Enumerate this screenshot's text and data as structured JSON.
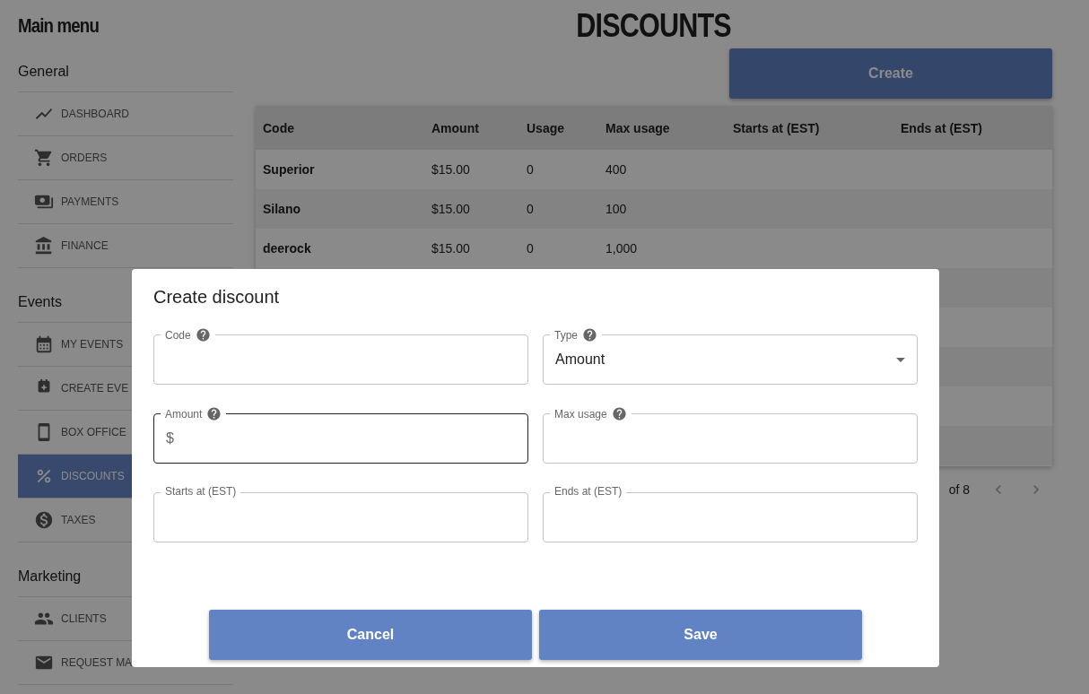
{
  "sidebar": {
    "title": "Main menu",
    "sections": [
      {
        "title": "General",
        "items": [
          {
            "label": "DASHBOARD",
            "selected": false
          },
          {
            "label": "ORDERS",
            "selected": false
          },
          {
            "label": "PAYMENTS",
            "selected": false
          },
          {
            "label": "FINANCE",
            "selected": false
          }
        ]
      },
      {
        "title": "Events",
        "items": [
          {
            "label": "MY EVENTS",
            "selected": false
          },
          {
            "label": "CREATE EVE",
            "selected": false
          },
          {
            "label": "BOX OFFICE",
            "selected": false
          },
          {
            "label": "DISCOUNTS",
            "selected": true
          },
          {
            "label": "TAXES",
            "selected": false
          }
        ]
      },
      {
        "title": "Marketing",
        "items": [
          {
            "label": "CLIENTS",
            "selected": false
          },
          {
            "label": "REQUEST MA",
            "selected": false
          }
        ]
      }
    ]
  },
  "page": {
    "title": "DISCOUNTS",
    "create_button": "Create"
  },
  "table": {
    "columns": [
      "Code",
      "Amount",
      "Usage",
      "Max usage",
      "Starts at (EST)",
      "Ends at (EST)"
    ],
    "rows": [
      [
        "Superior",
        "$15.00",
        "0",
        "400"
      ],
      [
        "Silano",
        "$15.00",
        "0",
        "100"
      ],
      [
        "deerock",
        "$15.00",
        "0",
        "1,000"
      ]
    ]
  },
  "pagination": {
    "label": "of 8"
  },
  "dialog": {
    "title": "Create discount",
    "fields": [
      {
        "kind": "text",
        "label": "Code",
        "help": true,
        "focused": false
      },
      {
        "kind": "select",
        "label": "Type",
        "help": true,
        "focused": false,
        "value": "Amount"
      },
      {
        "kind": "text",
        "label": "Amount",
        "help": true,
        "focused": true,
        "prefix": "$"
      },
      {
        "kind": "text",
        "label": "Max usage",
        "help": true,
        "focused": false
      },
      {
        "kind": "text",
        "label": "Starts at (EST)",
        "help": false,
        "focused": false
      },
      {
        "kind": "text",
        "label": "Ends at (EST)",
        "help": false,
        "focused": false
      }
    ],
    "buttons": [
      "Cancel",
      "Save"
    ]
  }
}
